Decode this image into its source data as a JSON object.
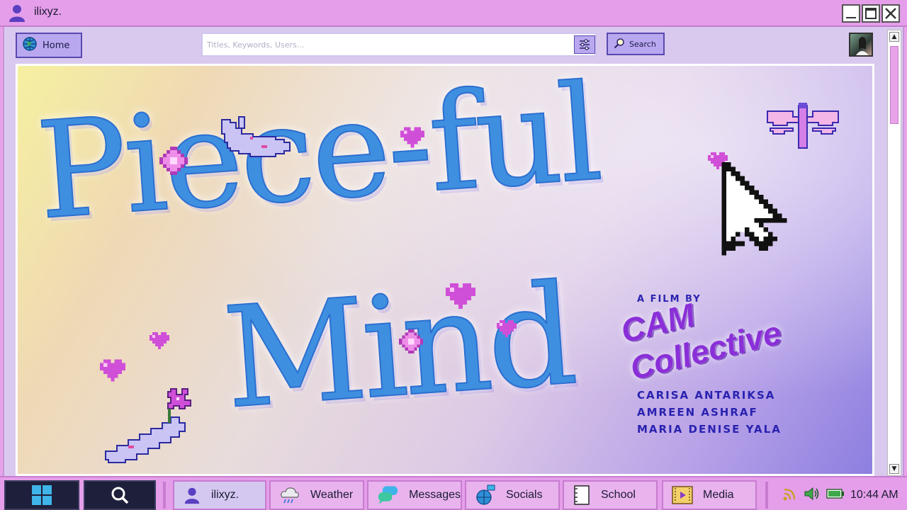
{
  "window": {
    "title": "ilixyz."
  },
  "toolbar": {
    "home_label": "Home",
    "search_placeholder": "Titles, Keywords, Users...",
    "search_value": "",
    "search_button_label": "Search"
  },
  "banner": {
    "title_line1": "Piece-ful",
    "title_line2": "Mind",
    "film_by": "A FILM BY",
    "studio": "CAM Collective",
    "credits": [
      "CARISA ANTARIKSA",
      "AMREEN ASHRAF",
      "MARIA DENISE YALA"
    ]
  },
  "taskbar": {
    "items": [
      {
        "label": "ilixyz.",
        "icon": "user-icon"
      },
      {
        "label": "Weather",
        "icon": "cloud-rain-icon"
      },
      {
        "label": "Messages",
        "icon": "chat-bubbles-icon"
      },
      {
        "label": "Socials",
        "icon": "globe-network-icon"
      },
      {
        "label": "School",
        "icon": "notebook-icon"
      },
      {
        "label": "Media",
        "icon": "film-play-icon"
      }
    ],
    "clock": "10:44 AM"
  },
  "colors": {
    "frame_pink": "#e59ee9",
    "button_lavender": "#b9a8ef",
    "title_blue": "#3f8fe0",
    "studio_purple": "#8a2fd8",
    "credit_navy": "#2a22b0",
    "taskbar_dark": "#1e1f3a"
  }
}
